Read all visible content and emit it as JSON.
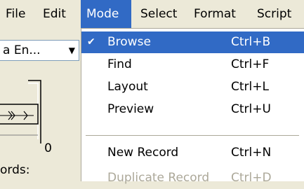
{
  "menubar": {
    "items": [
      {
        "label": "File"
      },
      {
        "label": "Edit"
      },
      {
        "label": "Mode"
      },
      {
        "label": "Select"
      },
      {
        "label": "Format"
      },
      {
        "label": "Script"
      }
    ]
  },
  "left_panel": {
    "layout_select_value": "a En...",
    "record_number": "0",
    "records_label": "ords:"
  },
  "mode_menu": {
    "items": [
      {
        "label": "Browse",
        "shortcut": "Ctrl+B",
        "checked": true
      },
      {
        "label": "Find",
        "shortcut": "Ctrl+F"
      },
      {
        "label": "Layout",
        "shortcut": "Ctrl+L"
      },
      {
        "label": "Preview",
        "shortcut": "Ctrl+U"
      },
      {
        "label": "New Record",
        "shortcut": "Ctrl+N"
      },
      {
        "label": "Duplicate Record",
        "shortcut": "Ctrl+D",
        "disabled": true
      }
    ],
    "check_glyph": "✔"
  },
  "colors": {
    "highlight": "#316ac5",
    "menu_background": "#ece9d8",
    "disabled_text": "#aca899"
  }
}
